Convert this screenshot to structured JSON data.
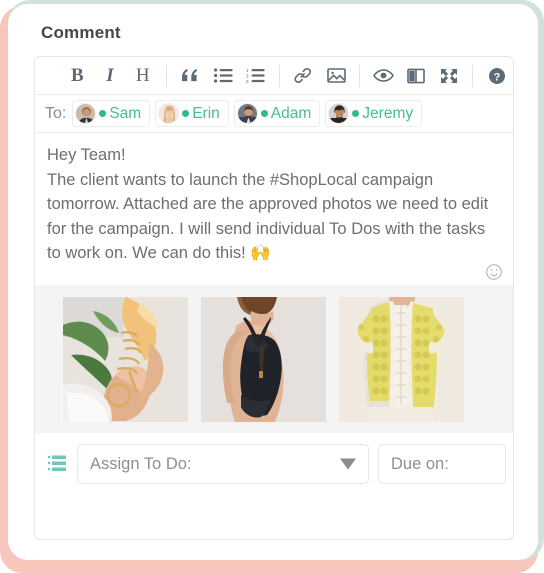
{
  "card": {
    "title": "Comment",
    "accent_color": "#45bd98",
    "frame_color": "#f7c6bd",
    "frame_color_secondary": "#cfe3da"
  },
  "toolbar": {
    "groups": [
      [
        {
          "name": "bold-icon",
          "label": "B"
        },
        {
          "name": "italic-icon",
          "label": "I"
        },
        {
          "name": "heading-icon",
          "label": "H"
        }
      ],
      [
        {
          "name": "blockquote-icon",
          "label": ""
        },
        {
          "name": "bulleted-list-icon",
          "label": ""
        },
        {
          "name": "numbered-list-icon",
          "label": ""
        }
      ],
      [
        {
          "name": "link-icon",
          "label": ""
        },
        {
          "name": "image-icon",
          "label": ""
        }
      ],
      [
        {
          "name": "preview-eye-icon",
          "label": ""
        },
        {
          "name": "split-view-icon",
          "label": ""
        },
        {
          "name": "fullscreen-icon",
          "label": ""
        }
      ],
      [
        {
          "name": "help-icon",
          "label": ""
        }
      ]
    ]
  },
  "recipients": {
    "label": "To:",
    "people": [
      {
        "name": "Sam",
        "status": "online"
      },
      {
        "name": "Erin",
        "status": "online"
      },
      {
        "name": "Adam",
        "status": "online"
      },
      {
        "name": "Jeremy",
        "status": "online"
      }
    ]
  },
  "message": {
    "text": "Hey Team!\nThe client wants to launch the #ShopLocal campaign tomorrow. Attached are the approved photos we need to edit for the campaign. I will send individual To Dos with the tasks to work on. We can do this! 🙌",
    "emoji_button": "emoji-picker-icon"
  },
  "attachments": [
    {
      "name": "attachment-rings-photo",
      "alt": "Hand wearing gold rings next to flowers"
    },
    {
      "name": "attachment-swimsuit-photo",
      "alt": "Model in black one-piece swimsuit"
    },
    {
      "name": "attachment-lace-top-photo",
      "alt": "Yellow lace top detail"
    }
  ],
  "footer": {
    "list_icon": "todo-list-icon",
    "assign": {
      "placeholder": "Assign To Do:",
      "value": "",
      "options": []
    },
    "due": {
      "placeholder": "Due on:",
      "value": ""
    }
  }
}
